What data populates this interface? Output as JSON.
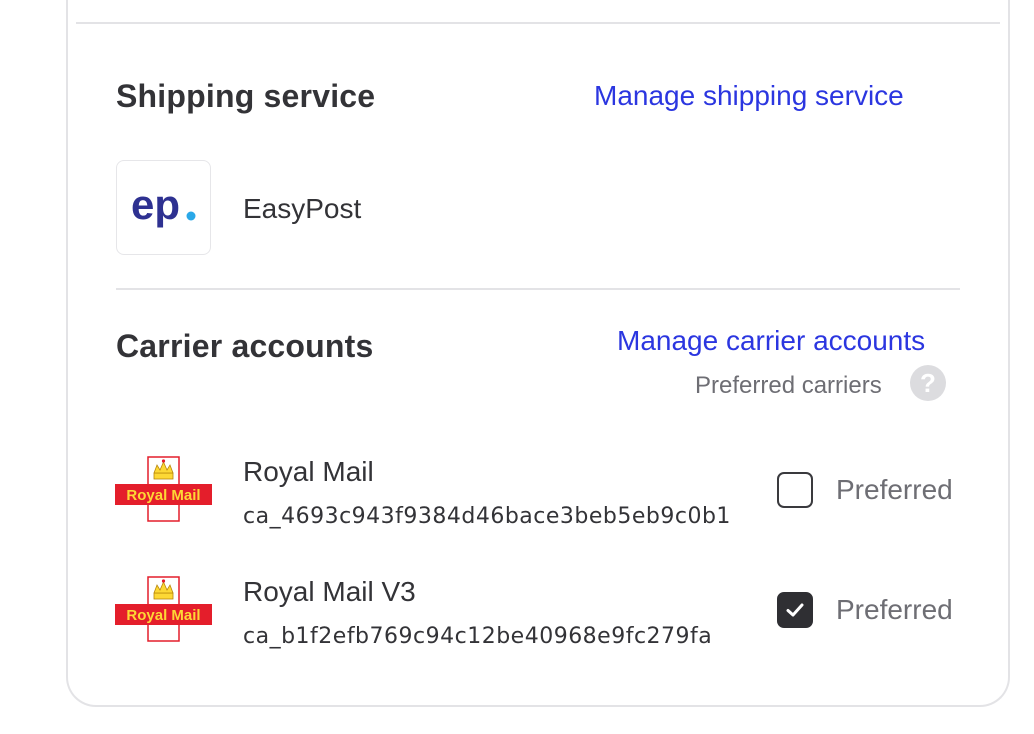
{
  "shipping": {
    "title": "Shipping service",
    "manage_link": "Manage shipping service",
    "service": {
      "name": "EasyPost",
      "logo_text": "ep",
      "logo_icon": "easypost-logo"
    }
  },
  "carriers": {
    "title": "Carrier accounts",
    "manage_link": "Manage carrier accounts",
    "preferred_carriers_label": "Preferred carriers",
    "help_icon": "question-circle-icon",
    "help_glyph": "?",
    "items": [
      {
        "name": "Royal Mail",
        "account_id": "ca_4693c943f9384d46bace3beb5eb9c0b1",
        "preferred": false,
        "preferred_label": "Preferred",
        "logo_text": "Royal Mail"
      },
      {
        "name": "Royal Mail V3",
        "account_id": "ca_b1f2efb769c94c12be40968e9fc279fa",
        "preferred": true,
        "preferred_label": "Preferred",
        "logo_text": "Royal Mail"
      }
    ]
  },
  "colors": {
    "link": "#2b36e0",
    "easypost_blue": "#2e3191",
    "easypost_dot": "#2aa8e8",
    "royal_mail_red": "#e41e2b",
    "royal_mail_yellow": "#fdd835"
  }
}
